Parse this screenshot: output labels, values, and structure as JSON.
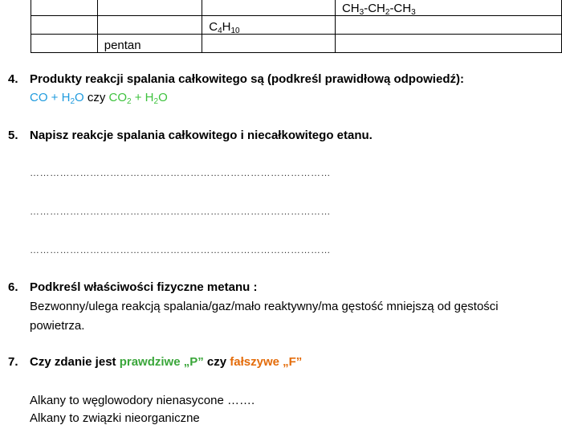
{
  "table": {
    "row1": {
      "c4_main": "CH",
      "c4_sub1": "3",
      "c4_mid1": "-CH",
      "c4_sub2": "2",
      "c4_mid2": "-CH",
      "c4_sub3": "3"
    },
    "row2": {
      "c3_main": "C",
      "c3_sub1": "4",
      "c3_mid": "H",
      "c3_sub2": "10"
    },
    "row3": {
      "c2": "pentan"
    }
  },
  "q4": {
    "num": "4.",
    "text": "Produkty reakcji spalania całkowitego są (podkreśl prawidłową odpowiedź):",
    "answer_a_1": "CO + H",
    "answer_a_sub": "2",
    "answer_a_2": "O",
    "or": " czy ",
    "answer_b_1": "CO",
    "answer_b_sub1": "2",
    "answer_b_2": " + H",
    "answer_b_sub2": "2",
    "answer_b_3": "O"
  },
  "q5": {
    "num": "5.",
    "text": "Napisz reakcje spalania całkowitego i niecałkowitego etanu.",
    "dots": "………………………………………………………………………………"
  },
  "q6": {
    "num": "6.",
    "text": "Podkreśl właściwości fizyczne metanu :",
    "line1": "Bezwonny/ulega reakcją spalania/gaz/mało reaktywny/ma gęstość mniejszą od gęstości",
    "line2": "powietrza."
  },
  "q7": {
    "num": "7.",
    "text_a": "Czy zdanie jest ",
    "true_label": "prawdziwe „P”",
    "text_b": " czy ",
    "false_label": "fałszywe „F”",
    "s1": "Alkany to węglowodory nienasycone …….",
    "s2": "Alkany to związki nieorganiczne"
  },
  "colors": {
    "blue": "#1f9bde",
    "green": "#3ec23e",
    "orange": "#e46c0a"
  }
}
